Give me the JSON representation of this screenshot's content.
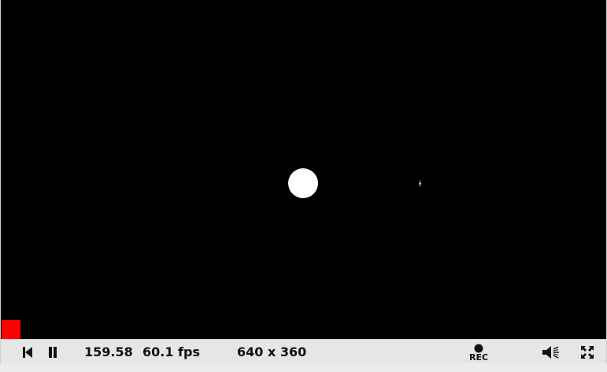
{
  "player": {
    "time": "159.58",
    "fps": "60.1 fps",
    "resolution": "640 x 360",
    "rec_label": "REC"
  },
  "colors": {
    "canvas_bg": "#000000",
    "controls_bg": "#e6e6e6",
    "sun": "#ffffff",
    "record_marker": "#ff0000"
  },
  "icons": [
    "rewind-icon",
    "pause-icon",
    "record-icon",
    "volume-icon",
    "fullscreen-icon"
  ]
}
